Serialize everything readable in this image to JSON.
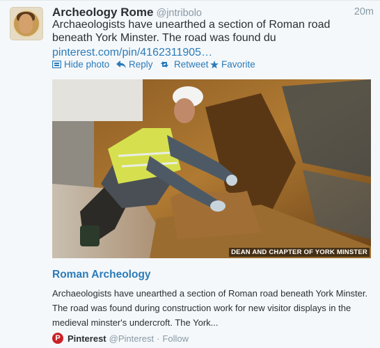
{
  "tweet": {
    "name": "Archeology Rome",
    "handle": "@jntribolo",
    "time": "20m",
    "text": "Archaeologists have unearthed a section of Roman road beneath York Minster. The road was found du",
    "link": "pinterest.com/pin/4162311905…"
  },
  "actions": {
    "hide_photo": "Hide photo",
    "reply": "Reply",
    "retweet": "Retweet",
    "favorite": "Favorite"
  },
  "media": {
    "credit": "DEAN AND CHAPTER OF YORK MINSTER"
  },
  "card": {
    "title": "Roman Archeology",
    "description": "Archaeologists have unearthed a section of Roman road beneath York Minster. The road was found during construction work for new visitor displays in the medieval minster's undercroft. The York..."
  },
  "source": {
    "logo_letter": "P",
    "name": "Pinterest",
    "handle": "@Pinterest",
    "separator": "·",
    "follow": "Follow"
  },
  "colors": {
    "link": "#2b7bb9",
    "muted": "#8899a6",
    "pinterest_red": "#cb2027"
  }
}
